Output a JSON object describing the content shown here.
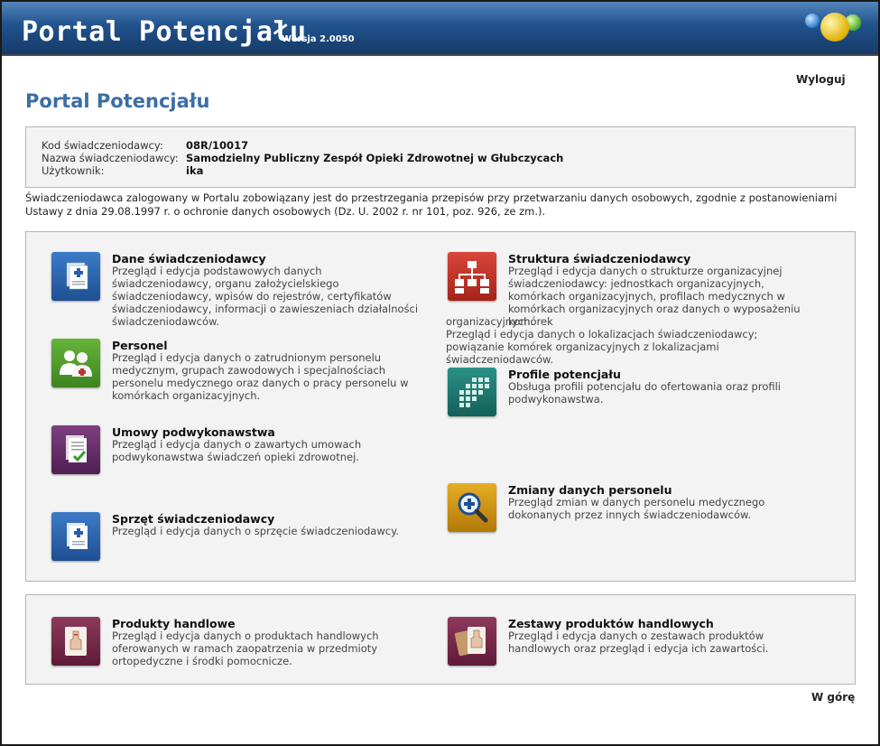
{
  "header": {
    "title": "Portal Potencjału",
    "version": "Wersja 2.0050"
  },
  "logout_label": "Wyloguj",
  "page_title": "Portal Potencjału",
  "info": {
    "code_label": "Kod świadczeniodawcy:",
    "code_value": "08R/10017",
    "name_label": "Nazwa świadczeniodawcy:",
    "name_value": "Samodzielny Publiczny Zespół Opieki Zdrowotnej w Głubczycach",
    "user_label": "Użytkownik:",
    "user_value": "ika"
  },
  "notice": "Świadczeniodawca zalogowany w Portalu zobowiązany jest do przestrzegania przepisów przy przetwarzaniu danych osobowych, zgodnie z postanowieniami Ustawy z dnia 29.08.1997 r. o ochronie danych osobowych (Dz. U. 2002 r. nr 101, poz. 926, ze zm.).",
  "tiles": [
    {
      "title": "Dane świadczeniodawcy",
      "desc": "Przegląd i edycja podstawowych danych świadczeniodawcy, organu założycielskiego świadczeniodawcy, wpisów do rejestrów, certyfikatów świadczeniodawcy, informacji o zawieszeniach działalności świadczeniodawców.",
      "icon": "document-icon",
      "color": "#2a5fa6"
    },
    {
      "title": "Personel",
      "desc": "Przegląd i edycja danych o zatrudnionym personelu medycznym, grupach zawodowych i specjalnościach personelu medycznego oraz danych o pracy personelu w komórkach organizacyjnych.",
      "icon": "medical-staff-icon",
      "color": "#4d9a2a"
    },
    {
      "title": "Umowy podwykonawstwa",
      "desc": "Przegląd i edycja danych o zawartych umowach podwykonawstwa świadczeń opieki zdrowotnej.",
      "icon": "contract-icon",
      "color": "#6a2f6a"
    },
    {
      "title": "Sprzęt świadczeniodawcy",
      "desc": "Przegląd i edycja danych o sprzęcie świadczeniodawcy.",
      "icon": "equipment-document-icon",
      "color": "#2a5fa6"
    },
    {
      "title": "Struktura świadczeniodawcy",
      "desc": "Przegląd i edycja danych o strukturze organizacyjnej świadczeniodawcy: jednostkach organizacyjnych, komórkach organizacyjnych, profilach medycznych w komórkach organizacyjnych oraz danych o wyposażeniu komórek",
      "desc_cont": "organizacyjnych.",
      "desc2": "Przegląd i edycja danych o lokalizacjach świadczeniodawcy; powiązanie komórek organizacyjnych z lokalizacjami świadczeniodawców.",
      "icon": "org-chart-icon",
      "color": "#c0302a"
    },
    {
      "title": "Profile potencjału",
      "desc": "Obsługa profili potencjału do ofertowania oraz profili podwykonawstwa.",
      "icon": "grid-icon",
      "color": "#1e7a73"
    },
    {
      "title": "Zmiany danych personelu",
      "desc": "Przegląd zmian w danych personelu medycznego dokonanych przez innych świadczeniodawców.",
      "icon": "magnifier-icon",
      "color": "#d69a12"
    },
    {
      "title": "Produkty handlowe",
      "desc": "Przegląd i edycja danych o produktach handlowych oferowanych w ramach zaopatrzenia w przedmioty ortopedyczne i środki pomocnicze.",
      "icon": "product-icon",
      "color": "#7a2a4a"
    },
    {
      "title": "Zestawy produktów handlowych",
      "desc": "Przegląd i edycja danych o zestawach produktów handlowych oraz przegląd i edycja ich zawartości.",
      "icon": "product-set-icon",
      "color": "#7a2a4a"
    }
  ],
  "up_label": "W górę"
}
